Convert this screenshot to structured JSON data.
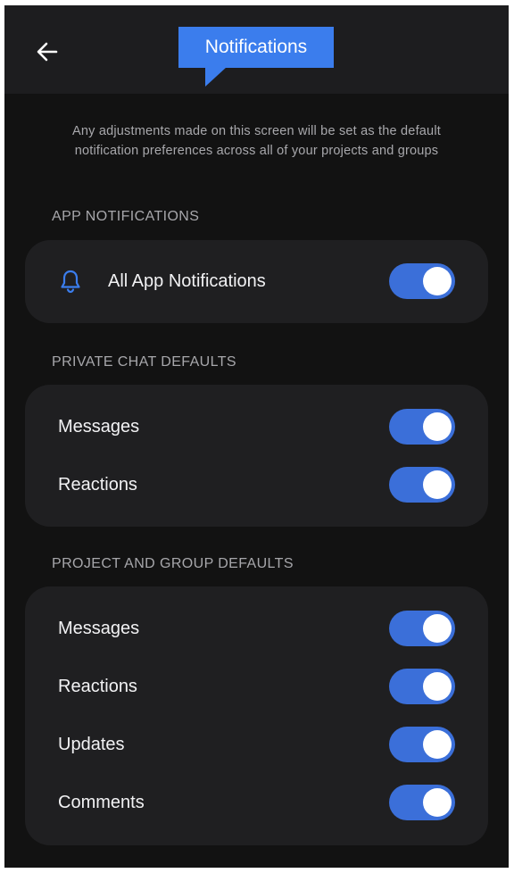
{
  "header": {
    "title": "Notifications"
  },
  "description": "Any adjustments made on this screen will be set as the default notification preferences across all of your projects and groups",
  "sections": [
    {
      "heading": "APP NOTIFICATIONS",
      "items": [
        {
          "label": "All App Notifications",
          "icon": "bell-icon",
          "on": true
        }
      ]
    },
    {
      "heading": "PRIVATE CHAT DEFAULTS",
      "items": [
        {
          "label": "Messages",
          "on": true
        },
        {
          "label": "Reactions",
          "on": true
        }
      ]
    },
    {
      "heading": "PROJECT AND GROUP DEFAULTS",
      "items": [
        {
          "label": "Messages",
          "on": true
        },
        {
          "label": "Reactions",
          "on": true
        },
        {
          "label": "Updates",
          "on": true
        },
        {
          "label": "Comments",
          "on": true
        }
      ]
    }
  ],
  "colors": {
    "accent": "#3b7ded",
    "toggle_on": "#3b6fd9",
    "background": "#121212",
    "card": "#1f1f21"
  }
}
